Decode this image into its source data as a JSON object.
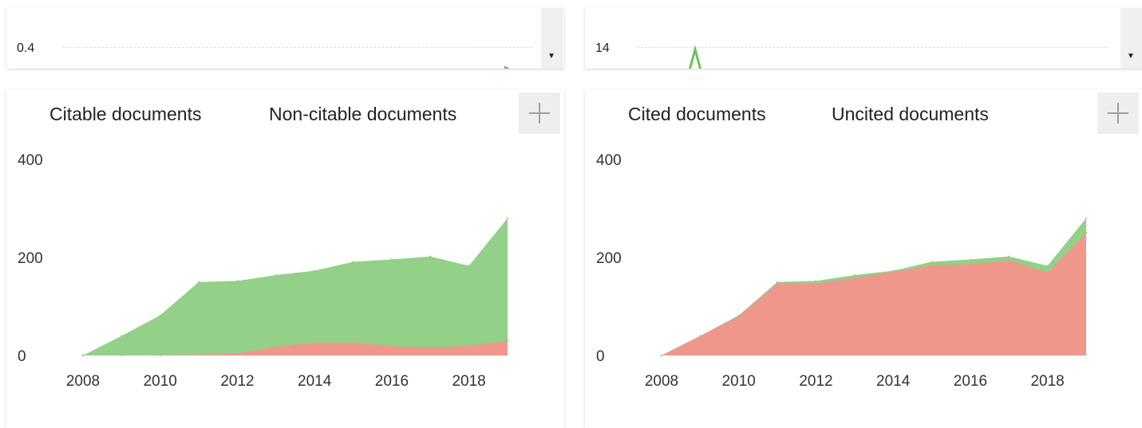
{
  "top_left": {
    "tick_label": "0.4"
  },
  "top_right": {
    "tick_label": "14"
  },
  "colors": {
    "green": "#93d088",
    "red": "#f0978c",
    "spike_green": "#6cc160",
    "spike_blue": "#3d7fc2"
  },
  "chart_data": [
    {
      "type": "area",
      "stacked": true,
      "legend": [
        "Citable documents",
        "Non-citable documents"
      ],
      "x": [
        2008,
        2009,
        2010,
        2011,
        2012,
        2013,
        2014,
        2015,
        2016,
        2017,
        2018,
        2019
      ],
      "series": [
        {
          "name": "Non-citable documents",
          "color": "#f0978c",
          "values": [
            0,
            0,
            0,
            2,
            4,
            18,
            26,
            26,
            19,
            16,
            20,
            30
          ]
        },
        {
          "name": "Citable documents",
          "color": "#93d088",
          "values": [
            0,
            40,
            82,
            148,
            148,
            146,
            147,
            165,
            177,
            186,
            163,
            250
          ]
        }
      ],
      "ylim": [
        0,
        400
      ],
      "yticks": [
        "0",
        "200",
        "400"
      ],
      "xticks": [
        "2008",
        "2010",
        "2012",
        "2014",
        "2016",
        "2018"
      ]
    },
    {
      "type": "area",
      "stacked": true,
      "legend": [
        "Cited documents",
        "Uncited documents"
      ],
      "x": [
        2008,
        2009,
        2010,
        2011,
        2012,
        2013,
        2014,
        2015,
        2016,
        2017,
        2018,
        2019
      ],
      "series": [
        {
          "name": "Uncited documents",
          "color": "#f0978c",
          "values": [
            0,
            40,
            80,
            148,
            146,
            158,
            170,
            184,
            186,
            194,
            169,
            250
          ]
        },
        {
          "name": "Cited documents",
          "color": "#93d088",
          "values": [
            0,
            0,
            2,
            2,
            6,
            6,
            3,
            7,
            10,
            8,
            14,
            30
          ]
        }
      ],
      "ylim": [
        0,
        400
      ],
      "yticks": [
        "0",
        "200",
        "400"
      ],
      "xticks": [
        "2008",
        "2010",
        "2012",
        "2014",
        "2016",
        "2018"
      ]
    }
  ]
}
